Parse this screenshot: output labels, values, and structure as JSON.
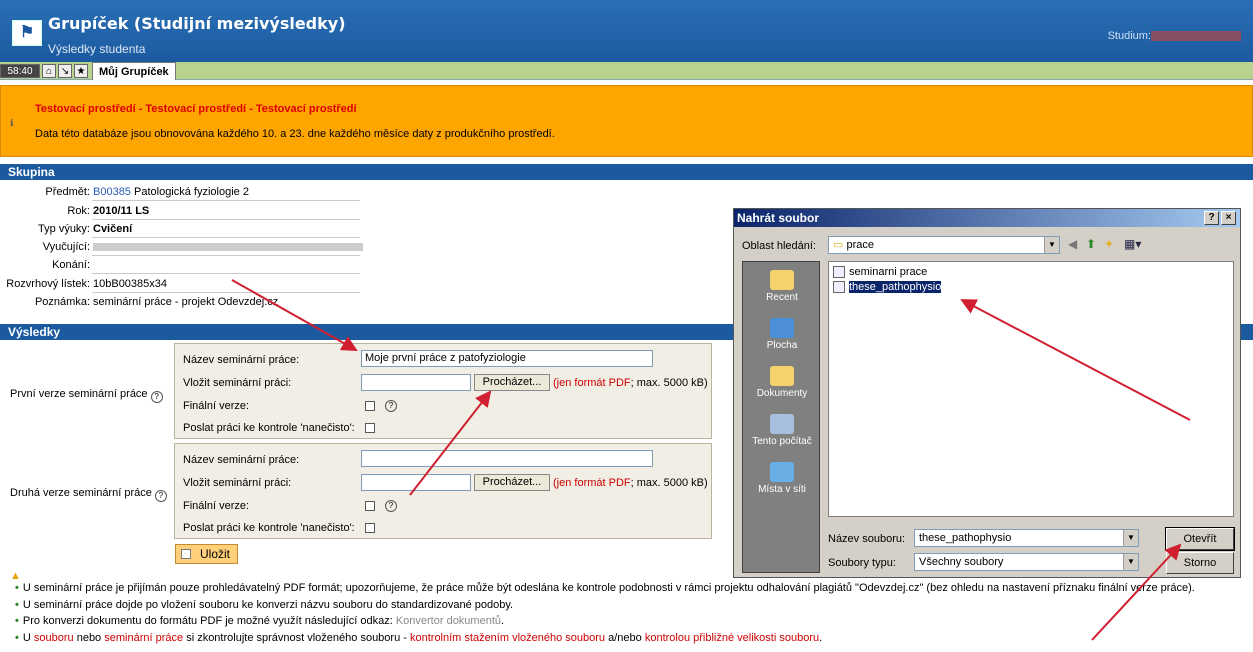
{
  "header": {
    "title": "Grupíček (Studijní mezivýsledky)",
    "subtitle": "Výsledky studenta",
    "studium_label": "Studium:"
  },
  "tabbar": {
    "timer": "58:40",
    "tab": "Můj Grupíček"
  },
  "warning": {
    "line1": "Testovací prostředí - Testovací prostředí - Testovací prostředí",
    "line2": "Data této databáze jsou obnovována každého 10. a 23. dne každého měsíce daty z produkčního prostředí."
  },
  "group": {
    "section": "Skupina",
    "predmet_label": "Předmět:",
    "predmet_code": "B00385",
    "predmet_name": "Patologická fyziologie 2",
    "rok_label": "Rok:",
    "rok": "2010/11 LS",
    "typ_label": "Typ výuky:",
    "typ": "Cvičení",
    "vyucujici_label": "Vyučující:",
    "konani_label": "Konání:",
    "listek_label": "Rozvrhový lístek:",
    "listek": "10bB00385x34",
    "poznamka_label": "Poznámka:",
    "poznamka": "seminární práce - projekt Odevzdej.cz"
  },
  "results": {
    "section": "Výsledky",
    "first_label": "První verze seminární práce",
    "second_label": "Druhá verze seminární práce",
    "name_label": "Název seminární práce:",
    "name_value": "Moje první práce z patofyziologie",
    "upload_label": "Vložit seminární práci:",
    "browse": "Procházet...",
    "pdf_note": "(jen formát PDF",
    "size_note": "; max. 5000 kB)",
    "final_label": "Finální verze:",
    "check_label": "Poslat práci ke kontrole 'nanečisto':",
    "save": "Uložit"
  },
  "notes": [
    "U seminární práce je přijímán pouze prohledávatelný PDF formát; upozorňujeme, že práce může být odeslána ke kontrole podobnosti v rámci projektu odhalování plagiátů \"Odevzdej.cz\" (bez ohledu na nastavení příznaku finální verze práce).",
    "U seminární práce dojde po vložení souboru ke konverzi názvu souboru do standardizované podoby.",
    "Pro konverzi dokumentu do formátu PDF je možné využít následující odkaz:",
    "Konvertor dokumentů",
    "U",
    "souboru",
    "nebo",
    "seminární práce",
    "si zkontrolujte správnost vloženého souboru -",
    "kontrolním stažením vloženého souboru",
    "a/nebo",
    "kontrolou přibližné velikosti souboru"
  ],
  "dialog": {
    "title": "Nahrát soubor",
    "help": "?",
    "close": "×",
    "look_in_label": "Oblast hledání:",
    "look_in": "prace",
    "places": [
      "Recent",
      "Plocha",
      "Dokumenty",
      "Tento počítač",
      "Místa v síti"
    ],
    "files": [
      "seminarni prace",
      "these_pathophysio"
    ],
    "filename_label": "Název souboru:",
    "filename": "these_pathophysio",
    "filetype_label": "Soubory typu:",
    "filetype": "Všechny soubory",
    "open": "Otevřít",
    "cancel": "Storno"
  }
}
